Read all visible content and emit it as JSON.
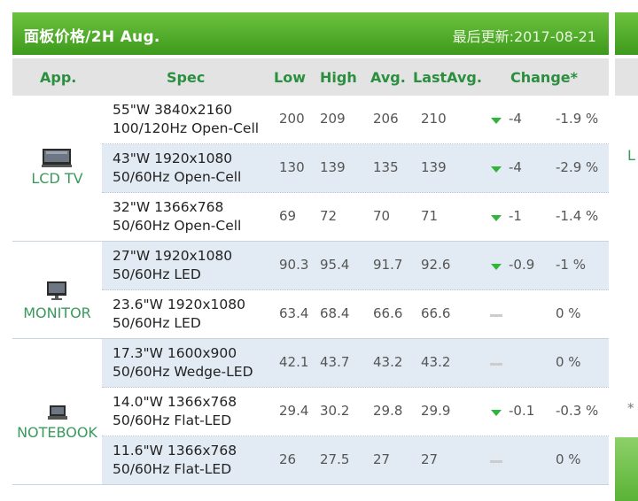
{
  "header": {
    "title": "面板价格/2H Aug.",
    "updated": "最后更新:2017-08-21"
  },
  "columns": {
    "app": "App.",
    "spec": "Spec",
    "low": "Low",
    "high": "High",
    "avg": "Avg.",
    "lastavg": "LastAvg.",
    "change": "Change*"
  },
  "categories": [
    {
      "label": "LCD TV",
      "icon": "tv-icon"
    },
    {
      "label": "MONITOR",
      "icon": "monitor-icon"
    },
    {
      "label": "NOTEBOOK",
      "icon": "notebook-icon"
    }
  ],
  "rows": [
    {
      "spec1": "55\"W 3840x2160",
      "spec2": "100/120Hz Open-Cell",
      "low": "200",
      "high": "209",
      "avg": "206",
      "lastavg": "210",
      "change": "-4",
      "pct": "-1.9 %",
      "trend": "down"
    },
    {
      "spec1": "43\"W 1920x1080",
      "spec2": "50/60Hz Open-Cell",
      "low": "130",
      "high": "139",
      "avg": "135",
      "lastavg": "139",
      "change": "-4",
      "pct": "-2.9 %",
      "trend": "down"
    },
    {
      "spec1": "32\"W 1366x768",
      "spec2": "50/60Hz Open-Cell",
      "low": "69",
      "high": "72",
      "avg": "70",
      "lastavg": "71",
      "change": "-1",
      "pct": "-1.4 %",
      "trend": "down"
    },
    {
      "spec1": "27\"W 1920x1080",
      "spec2": "50/60Hz LED",
      "low": "90.3",
      "high": "95.4",
      "avg": "91.7",
      "lastavg": "92.6",
      "change": "-0.9",
      "pct": "-1 %",
      "trend": "down"
    },
    {
      "spec1": "23.6\"W 1920x1080",
      "spec2": "50/60Hz LED",
      "low": "63.4",
      "high": "68.4",
      "avg": "66.6",
      "lastavg": "66.6",
      "change": "",
      "pct": "0 %",
      "trend": "flat"
    },
    {
      "spec1": "17.3\"W 1600x900",
      "spec2": "50/60Hz Wedge-LED",
      "low": "42.1",
      "high": "43.7",
      "avg": "43.2",
      "lastavg": "43.2",
      "change": "",
      "pct": "0 %",
      "trend": "flat"
    },
    {
      "spec1": "14.0\"W 1366x768",
      "spec2": "50/60Hz Flat-LED",
      "low": "29.4",
      "high": "30.2",
      "avg": "29.8",
      "lastavg": "29.9",
      "change": "-0.1",
      "pct": "-0.3 %",
      "trend": "down"
    },
    {
      "spec1": "11.6\"W 1366x768",
      "spec2": "50/60Hz Flat-LED",
      "low": "26",
      "high": "27.5",
      "avg": "27",
      "lastavg": "27",
      "change": "",
      "pct": "0 %",
      "trend": "flat"
    }
  ],
  "edge": {
    "letter": "L",
    "asterisk": "*"
  },
  "colors": {
    "green": "#3e9a1c",
    "down": "#2fb53b",
    "alt_row": "#e2ebf4"
  }
}
